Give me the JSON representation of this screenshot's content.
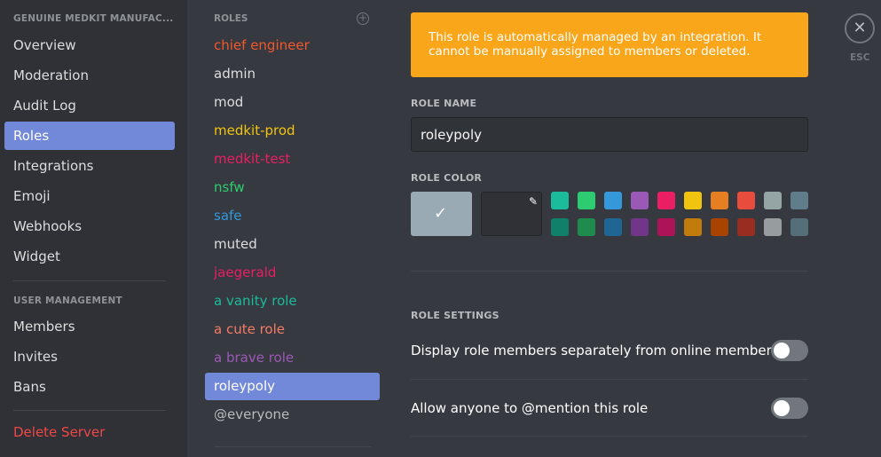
{
  "sidebar": {
    "server_header": "GENUINE MEDKIT MANUFAC...",
    "items": [
      "Overview",
      "Moderation",
      "Audit Log",
      "Roles",
      "Integrations",
      "Emoji",
      "Webhooks",
      "Widget"
    ],
    "user_mgmt_header": "USER MANAGEMENT",
    "user_items": [
      "Members",
      "Invites",
      "Bans"
    ],
    "delete_label": "Delete Server"
  },
  "roles": {
    "header": "ROLES",
    "list": [
      {
        "name": "chief engineer",
        "color": "#f1582b"
      },
      {
        "name": "admin",
        "color": "#dcddde"
      },
      {
        "name": "mod",
        "color": "#dcddde"
      },
      {
        "name": "medkit-prod",
        "color": "#f1c40f"
      },
      {
        "name": "medkit-test",
        "color": "#e91e63"
      },
      {
        "name": "nsfw",
        "color": "#2ecc71"
      },
      {
        "name": "safe",
        "color": "#3498db"
      },
      {
        "name": "muted",
        "color": "#dcddde"
      },
      {
        "name": "jaegerald",
        "color": "#e91e63"
      },
      {
        "name": "a vanity role",
        "color": "#1abc9c"
      },
      {
        "name": "a cute role",
        "color": "#f47b67"
      },
      {
        "name": "a brave role",
        "color": "#9b59b6"
      },
      {
        "name": "roleypoly",
        "color": "#ffffff"
      },
      {
        "name": "@everyone",
        "color": "#b9bbbe"
      }
    ]
  },
  "notice": {
    "text": "This role is automatically managed by an integration. It cannot be manually assigned to members or deleted.",
    "color": "#faa61a"
  },
  "role_name": {
    "label": "ROLE NAME",
    "value": "roleypoly"
  },
  "role_color": {
    "label": "ROLE COLOR",
    "default_color": "#99aab5",
    "swatches_top": [
      "#1abc9c",
      "#2ecc71",
      "#3498db",
      "#9b59b6",
      "#e91e63",
      "#f1c40f",
      "#e67e22",
      "#e74c3c",
      "#95a5a6",
      "#607d8b"
    ],
    "swatches_bottom": [
      "#11806a",
      "#1f8b4c",
      "#206694",
      "#71368a",
      "#ad1457",
      "#c27c0e",
      "#a84300",
      "#992d22",
      "#979c9f",
      "#546e7a"
    ]
  },
  "settings": {
    "label": "ROLE SETTINGS",
    "items": [
      "Display role members separately from online members",
      "Allow anyone to @mention this role"
    ]
  },
  "close": {
    "esc_label": "ESC"
  }
}
